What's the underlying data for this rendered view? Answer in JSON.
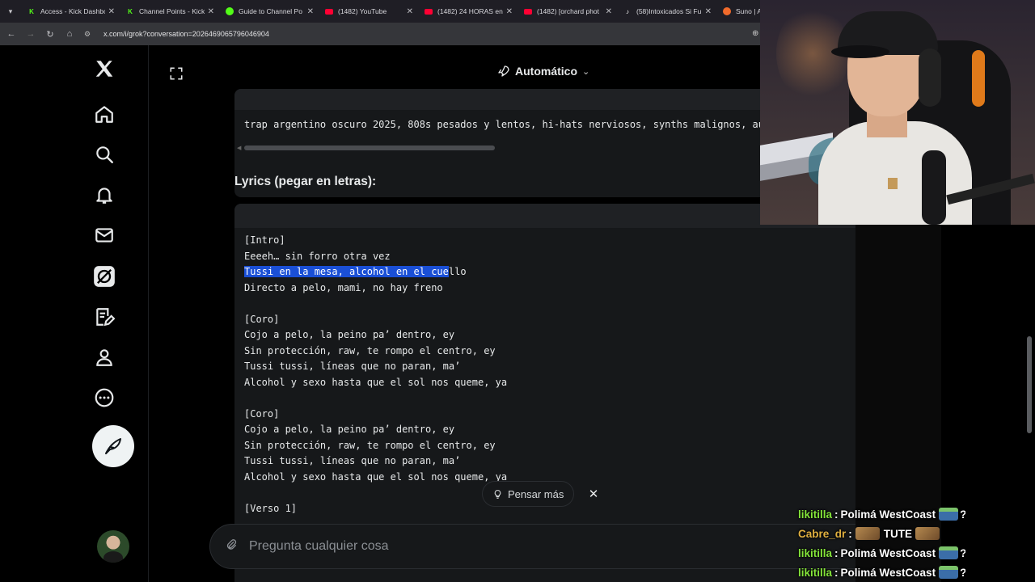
{
  "browser": {
    "tabs": [
      {
        "label": "Access - Kick Dashbo",
        "icon": "kick-icon",
        "color": "#53fc18"
      },
      {
        "label": "Channel Points - Kick",
        "icon": "kick-icon",
        "color": "#53fc18"
      },
      {
        "label": "Guide to Channel Po",
        "icon": "kick-guide-icon",
        "color": "#53fc18"
      },
      {
        "label": "(1482) YouTube",
        "icon": "youtube-icon",
        "color": "#ff0033"
      },
      {
        "label": "(1482) 24 HORAS en",
        "icon": "youtube-icon",
        "color": "#ff0033"
      },
      {
        "label": "(1482) [orchard phot",
        "icon": "youtube-icon",
        "color": "#ff0033"
      },
      {
        "label": "(58)Intoxicados Si Fu",
        "icon": "tiktok-icon",
        "color": "#ffffff"
      },
      {
        "label": "Suno | A",
        "icon": "suno-icon",
        "color": "#f26b2b"
      }
    ],
    "url": "x.com/i/grok?conversation=2026469065796046904"
  },
  "grok": {
    "mode_label": "Automático",
    "prompt_code": "trap argentino oscuro 2025, 808s pesados y lentos, hi-hats nerviosos, synths malignos, au",
    "section_title": "Lyrics (pegar en letras):",
    "lyrics": [
      {
        "text": "[Intro]",
        "highlight": "",
        "rest": ""
      },
      {
        "text": "Eeeeh… sin forro otra vez",
        "highlight": "",
        "rest": ""
      },
      {
        "text": "",
        "highlight": "Tussi en la mesa, alcohol en el cue",
        "rest": "llo"
      },
      {
        "text": "Directo a pelo, mami, no hay freno",
        "highlight": "",
        "rest": ""
      },
      {
        "text": "",
        "highlight": "",
        "rest": ""
      },
      {
        "text": "[Coro]",
        "highlight": "",
        "rest": ""
      },
      {
        "text": "Cojo a pelo, la peino pa’ dentro, ey",
        "highlight": "",
        "rest": ""
      },
      {
        "text": "Sin protección, raw, te rompo el centro, ey",
        "highlight": "",
        "rest": ""
      },
      {
        "text": "Tussi tussi, líneas que no paran, ma’",
        "highlight": "",
        "rest": ""
      },
      {
        "text": "Alcohol y sexo hasta que el sol nos queme, ya",
        "highlight": "",
        "rest": ""
      },
      {
        "text": "",
        "highlight": "",
        "rest": ""
      },
      {
        "text": "[Coro]",
        "highlight": "",
        "rest": ""
      },
      {
        "text": "Cojo a pelo, la peino pa’ dentro, ey",
        "highlight": "",
        "rest": ""
      },
      {
        "text": "Sin protección, raw, te rompo el centro, ey",
        "highlight": "",
        "rest": ""
      },
      {
        "text": "Tussi tussi, líneas que no paran, ma’",
        "highlight": "",
        "rest": ""
      },
      {
        "text": "Alcohol y sexo hasta que el sol nos queme, ya",
        "highlight": "",
        "rest": ""
      },
      {
        "text": "",
        "highlight": "",
        "rest": ""
      },
      {
        "text": "[Verso 1]",
        "highlight": "",
        "rest": ""
      }
    ],
    "think_more_label": "Pensar más",
    "ask_placeholder": "Pregunta cualquier cosa"
  },
  "sidebar": {
    "items": [
      "x-logo-icon",
      "home-icon",
      "search-icon",
      "notifications-icon",
      "messages-icon",
      "grok-icon",
      "drafts-icon",
      "profile-icon",
      "more-icon"
    ],
    "compose_icon": "compose-icon"
  },
  "chat": [
    {
      "user": "likitilla",
      "color": "#84e43a",
      "message": "Polimá WestCoast",
      "emote": "bus-emote",
      "suffix": "?"
    },
    {
      "user": "Cabre_dr",
      "color": "#e0b040",
      "message": "TUTE",
      "emote": "cat-emote",
      "suffix": ""
    },
    {
      "user": "likitilla",
      "color": "#84e43a",
      "message": "Polimá WestCoast",
      "emote": "bus-emote",
      "suffix": "?"
    },
    {
      "user": "likitilla",
      "color": "#84e43a",
      "message": "Polimá WestCoast",
      "emote": "bus-emote",
      "suffix": "?"
    }
  ]
}
